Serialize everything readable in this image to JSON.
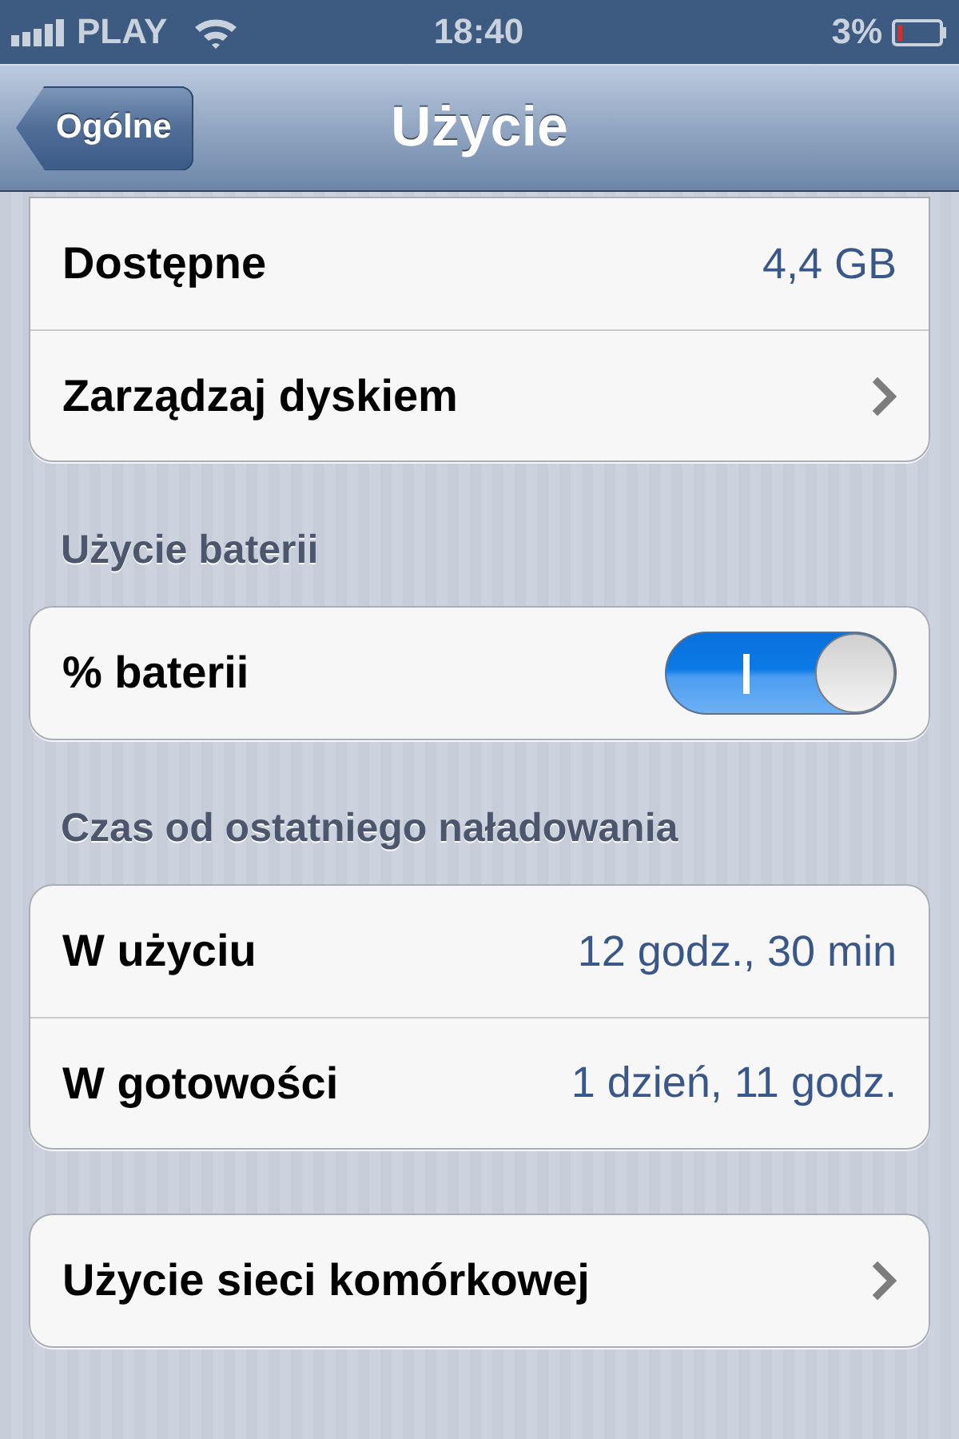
{
  "status_bar": {
    "carrier": "PLAY",
    "time": "18:40",
    "battery_percent": "3%"
  },
  "nav_bar": {
    "back_button": "Ogólne",
    "title": "Użycie"
  },
  "groups": [
    {
      "rows": [
        {
          "kind": "value",
          "label": "Dostępne",
          "value": "4,4 GB"
        },
        {
          "kind": "link",
          "label": "Zarządzaj dyskiem"
        }
      ]
    },
    {
      "header": "Użycie baterii",
      "rows": [
        {
          "kind": "switch",
          "label": "% baterii",
          "on": true
        }
      ]
    },
    {
      "header": "Czas od ostatniego naładowania",
      "rows": [
        {
          "kind": "value",
          "label": "W użyciu",
          "value": "12 godz., 30 min"
        },
        {
          "kind": "value",
          "label": "W gotowości",
          "value": "1 dzień, 11 godz."
        }
      ]
    },
    {
      "rows": [
        {
          "kind": "link",
          "label": "Użycie sieci komórkowej"
        }
      ]
    }
  ]
}
